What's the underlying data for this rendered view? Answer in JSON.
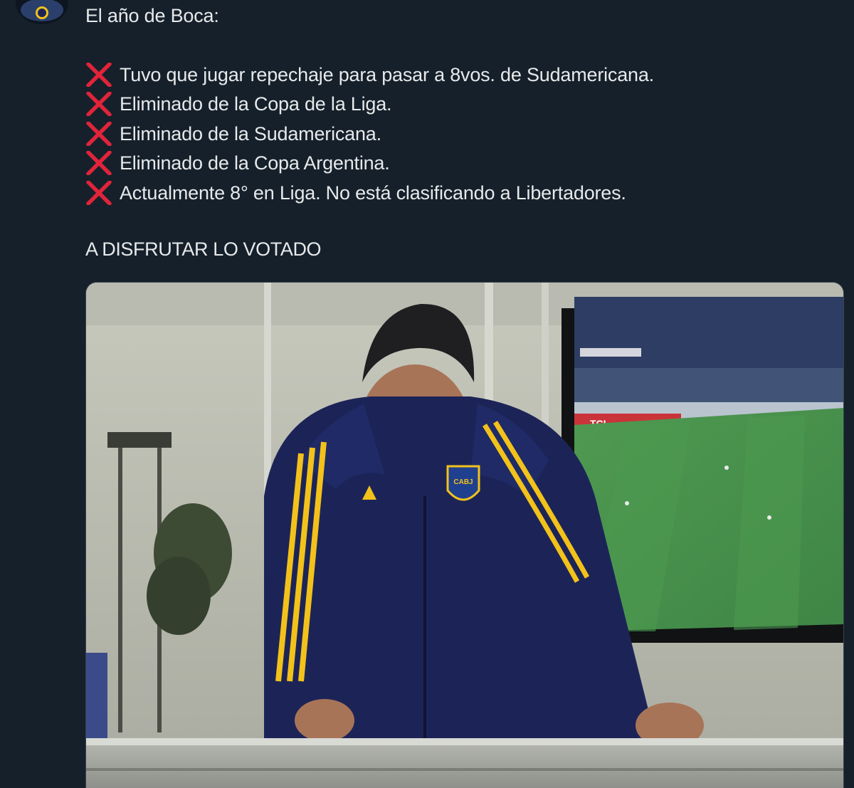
{
  "tweet": {
    "headline": "El año de Boca:",
    "items": [
      {
        "icon": "cross-mark-icon",
        "text": "Tuvo que jugar repechaje para pasar a 8vos. de Sudamericana."
      },
      {
        "icon": "cross-mark-icon",
        "text": "Eliminado de la Copa de la Liga."
      },
      {
        "icon": "cross-mark-icon",
        "text": "Eliminado de la Sudamericana."
      },
      {
        "icon": "cross-mark-icon",
        "text": "Eliminado de la Copa Argentina."
      },
      {
        "icon": "cross-mark-icon",
        "text": "Actualmente 8° en Liga. No está clasificando a Libertadores."
      }
    ],
    "closing": "A DISFRUTAR LO VOTADO"
  },
  "colors": {
    "background": "#15202b",
    "text": "#e7e9ea",
    "cross_mark": "#e0243a",
    "jacket_navy": "#1c2457",
    "stripe_yellow": "#f2c21b"
  },
  "media": {
    "tv_banner": "TCL",
    "badge_letters": "CABJ"
  }
}
